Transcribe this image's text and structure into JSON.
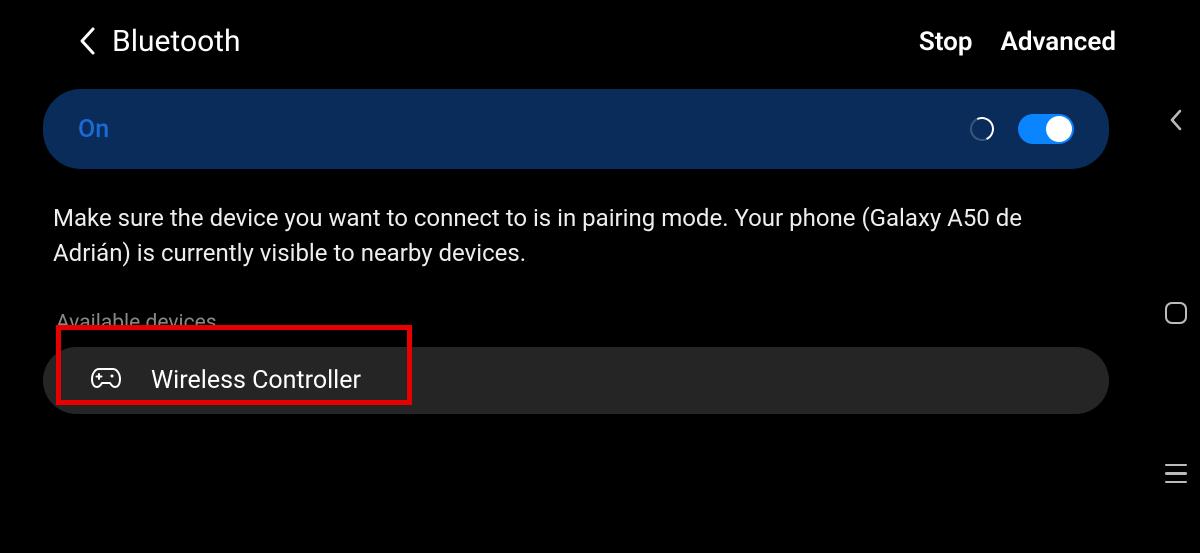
{
  "header": {
    "title": "Bluetooth",
    "actions": {
      "stop": "Stop",
      "advanced": "Advanced"
    }
  },
  "toggle": {
    "label": "On",
    "state": true
  },
  "info_text": "Make sure the device you want to connect to is in pairing mode. Your phone (Galaxy A50 de Adrián) is currently visible to nearby devices.",
  "section_header": "Available devices",
  "devices": [
    {
      "name": "Wireless Controller",
      "icon": "game-controller-icon"
    }
  ]
}
